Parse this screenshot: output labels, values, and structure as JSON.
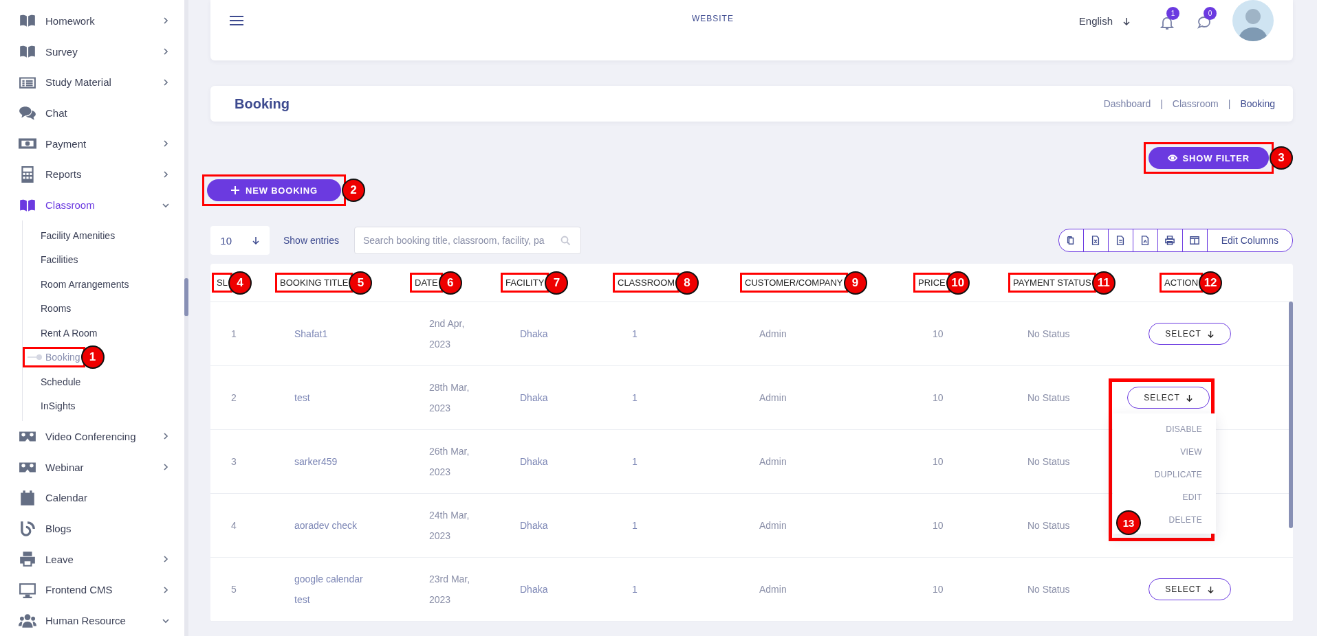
{
  "sidebar": {
    "items": [
      {
        "kind": "book",
        "label": "Homework",
        "selected": false,
        "expanded": false
      },
      {
        "kind": "book",
        "label": "Survey",
        "selected": false,
        "expanded": false
      },
      {
        "kind": "list",
        "label": "Study Material",
        "selected": false,
        "expanded": false
      },
      {
        "kind": "chat",
        "label": "Chat",
        "selected": false
      },
      {
        "kind": "money",
        "label": "Payment",
        "selected": false,
        "expanded": false
      },
      {
        "kind": "calculator",
        "label": "Reports",
        "selected": false,
        "expanded": false
      },
      {
        "kind": "book",
        "label": "Classroom",
        "selected": true,
        "expanded": true,
        "children": [
          {
            "label": "Facility Amenities",
            "selected": false
          },
          {
            "label": "Facilities",
            "selected": false
          },
          {
            "label": "Room Arrangements",
            "selected": false
          },
          {
            "label": "Rooms",
            "selected": false
          },
          {
            "label": "Rent A Room",
            "selected": false
          },
          {
            "label": "Booking",
            "selected": true,
            "callout": "1"
          },
          {
            "label": "Schedule",
            "selected": false
          },
          {
            "label": "InSights",
            "selected": false
          }
        ]
      },
      {
        "kind": "vr",
        "label": "Video Conferencing",
        "selected": false,
        "expanded": false
      },
      {
        "kind": "vr",
        "label": "Webinar",
        "selected": false,
        "expanded": false
      },
      {
        "kind": "calendar",
        "label": "Calendar",
        "selected": false
      },
      {
        "kind": "blog",
        "label": "Blogs",
        "selected": false
      },
      {
        "kind": "printer",
        "label": "Leave",
        "selected": false,
        "expanded": false
      },
      {
        "kind": "monitor",
        "label": "Frontend CMS",
        "selected": false,
        "expanded": false
      },
      {
        "kind": "users",
        "label": "Human Resource",
        "selected": false,
        "expanded": true
      }
    ]
  },
  "header": {
    "site_link": "WEBSITE",
    "language": "English",
    "notifications": "1",
    "messages": "0"
  },
  "page_title": "Booking",
  "breadcrumbs": [
    {
      "label": "Dashboard",
      "selected": false
    },
    {
      "label": "Classroom",
      "selected": false
    },
    {
      "label": "Booking",
      "selected": true
    }
  ],
  "breadcrumb_separators": [
    "|",
    "|"
  ],
  "show_filter_button": {
    "label": "SHOW FILTER",
    "callout": "3"
  },
  "new_booking_button": {
    "label": "NEW BOOKING",
    "callout": "2"
  },
  "entries": {
    "value": "10",
    "label": "Show entries"
  },
  "search": {
    "placeholder": "Search booking title, classroom, facility, pa"
  },
  "edit_columns": "Edit Columns",
  "table": {
    "columns": [
      {
        "label": "SL",
        "callout": "4"
      },
      {
        "label": "BOOKING TITLE",
        "callout": "5"
      },
      {
        "label": "DATE",
        "callout": "6"
      },
      {
        "label": "FACILITY",
        "callout": "7"
      },
      {
        "label": "CLASSROOM",
        "callout": "8"
      },
      {
        "label": "CUSTOMER/COMPANY",
        "callout": "9"
      },
      {
        "label": "PRICE",
        "callout": "10"
      },
      {
        "label": "PAYMENT STATUS",
        "callout": "11"
      },
      {
        "label": "ACTION",
        "callout": "12"
      }
    ],
    "rows": [
      {
        "sl": "1",
        "title": "Shafat1",
        "date": [
          "2nd Apr,",
          "2023"
        ],
        "facility": "Dhaka",
        "classroom": "1",
        "customer": "Admin",
        "price": "10",
        "status": "No Status",
        "action": {
          "label": "SELECT"
        }
      },
      {
        "sl": "2",
        "title": "test",
        "date": [
          "28th Mar,",
          "2023"
        ],
        "facility": "Dhaka",
        "classroom": "1",
        "customer": "Admin",
        "price": "10",
        "status": "No Status",
        "action": {
          "label": "SELECT",
          "callout": "13",
          "menu": [
            "DISABLE",
            "VIEW",
            "DUPLICATE",
            "EDIT",
            "DELETE"
          ]
        }
      },
      {
        "sl": "3",
        "title": "sarker459",
        "date": [
          "26th Mar,",
          "2023"
        ],
        "facility": "Dhaka",
        "classroom": "1",
        "customer": "Admin",
        "price": "10",
        "status": "No Status"
      },
      {
        "sl": "4",
        "title": "aoradev check",
        "date": [
          "24th Mar,",
          "2023"
        ],
        "facility": "Dhaka",
        "classroom": "1",
        "customer": "Admin",
        "price": "10",
        "status": "No Status"
      },
      {
        "sl": "5",
        "title": [
          "google calendar",
          "test"
        ],
        "date": [
          "23rd Mar,",
          "2023"
        ],
        "facility": "Dhaka",
        "classroom": "1",
        "customer": "Admin",
        "price": "10",
        "status": "No Status",
        "action": {
          "label": "SELECT"
        }
      }
    ]
  }
}
